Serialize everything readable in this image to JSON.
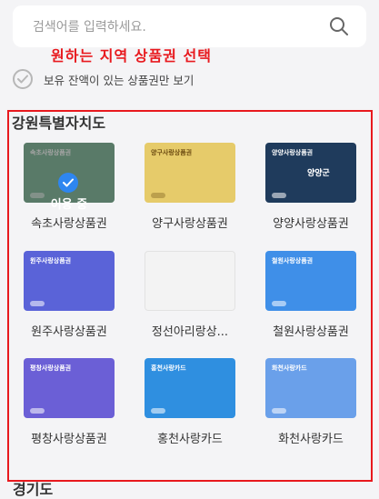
{
  "search": {
    "placeholder": "검색어를 입력하세요.",
    "icon": "search-icon"
  },
  "annotation": "원하는 지역 상품권 선택",
  "filter": {
    "label": "보유 잔액이 있는 상품권만 보기",
    "checked": false
  },
  "region": {
    "title": "강원특별자치도",
    "cards": [
      {
        "name": "속초사랑상품권",
        "header": "속초사랑상품권",
        "body": "",
        "color": "#5aa37a",
        "selected": true,
        "selected_label": "이용 중"
      },
      {
        "name": "양구사랑상품권",
        "header": "양구사랑상품권",
        "body": "",
        "color": "#e6cb6a",
        "selected": false
      },
      {
        "name": "양양사랑상품권",
        "header": "양양사랑상품권",
        "body": "양양군",
        "color": "#1f3b5c",
        "selected": false
      },
      {
        "name": "원주사랑상품권",
        "header": "원주사랑상품권",
        "body": "",
        "color": "#5a63d8",
        "selected": false
      },
      {
        "name": "정선아리랑상...",
        "header": "",
        "body": "",
        "color": "#f3f3f3",
        "selected": false
      },
      {
        "name": "철원사랑상품권",
        "header": "철원사랑상품권",
        "body": "",
        "color": "#3f8fe8",
        "selected": false
      },
      {
        "name": "평창사랑상품권",
        "header": "평창사랑상품권",
        "body": "",
        "color": "#6b5fd6",
        "selected": false
      },
      {
        "name": "홍천사랑카드",
        "header": "홍천사랑카드",
        "body": "",
        "color": "#2f8fe0",
        "selected": false
      },
      {
        "name": "화천사랑카드",
        "header": "화천사랑카드",
        "body": "",
        "color": "#6aa0ea",
        "selected": false
      }
    ]
  },
  "next_region": {
    "title": "경기도"
  }
}
